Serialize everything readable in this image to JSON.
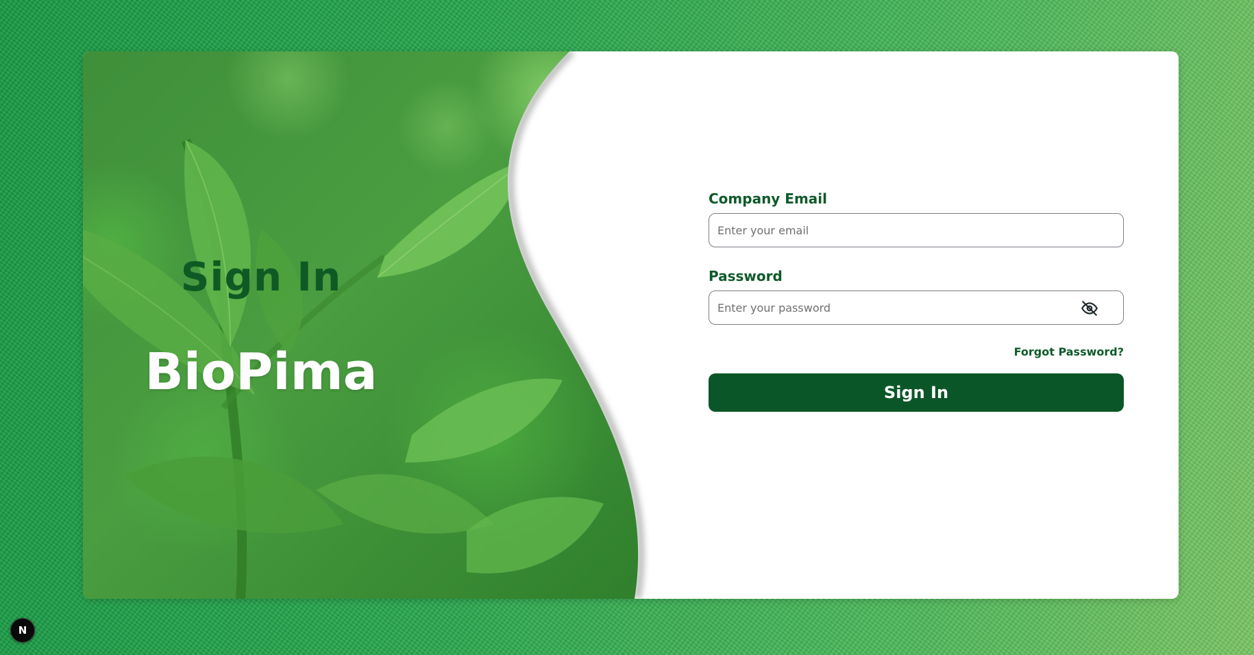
{
  "hero": {
    "title": "Sign In",
    "brand": "BioPima"
  },
  "form": {
    "email_label": "Company Email",
    "email_placeholder": "Enter your email",
    "email_value": "",
    "password_label": "Password",
    "password_placeholder": "Enter your password",
    "password_value": "",
    "password_toggle_icon": "eye-off-icon",
    "forgot_label": "Forgot Password?",
    "submit_label": "Sign In"
  },
  "dev_badge": {
    "label": "N",
    "icon": "nextjs-logo-icon"
  },
  "colors": {
    "accent": "#0b5628",
    "label": "#0f5a2a",
    "hero_title": "#0f5a24",
    "background": "#2aa94f"
  }
}
